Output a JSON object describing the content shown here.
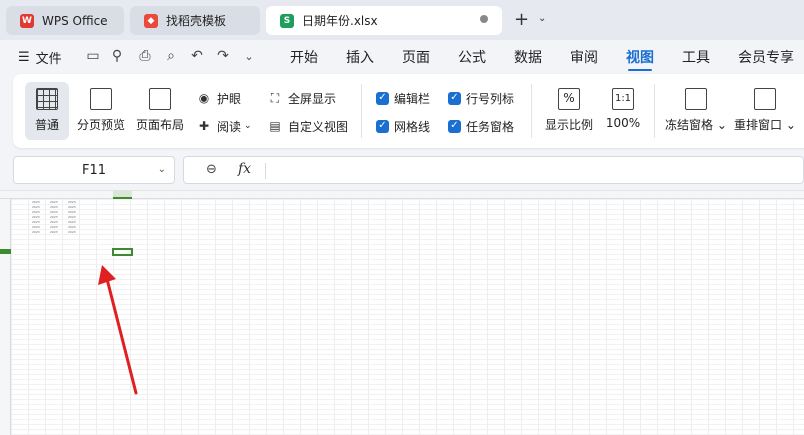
{
  "tabs": [
    {
      "label": "WPS Office",
      "icon": "wps-logo-icon",
      "color": "#e0392f"
    },
    {
      "label": "找稻壳模板",
      "icon": "docer-logo-icon",
      "color": "#e84a3c"
    },
    {
      "label": "日期年份.xlsx",
      "icon": "spreadsheet-s-icon",
      "color": "#1e9e5a"
    }
  ],
  "menubar": {
    "file_label": "文件",
    "tabs": [
      "开始",
      "插入",
      "页面",
      "公式",
      "数据",
      "审阅",
      "视图",
      "工具",
      "会员专享"
    ],
    "active_tab": "视图"
  },
  "ribbon": {
    "normal": "普通",
    "page_break": "分页预览",
    "page_layout": "页面布局",
    "eye_care": "护眼",
    "reading": "阅读",
    "fullscreen": "全屏显示",
    "custom_view": "自定义视图",
    "formula_bar": "编辑栏",
    "headings": "行号列标",
    "gridlines": "网格线",
    "task_pane": "任务窗格",
    "zoom_ratio": "显示比例",
    "zoom_100": "100%",
    "freeze": "冻结窗格",
    "arrange": "重排窗口"
  },
  "formula_bar": {
    "cell_ref": "F11",
    "fx": "fx",
    "content": ""
  },
  "sheet": {
    "cells": [
      "2023",
      "2023",
      "2023"
    ]
  },
  "colors": {
    "accent": "#1a6fd1",
    "selection": "#3c8c2f",
    "arrow": "#e02020"
  }
}
